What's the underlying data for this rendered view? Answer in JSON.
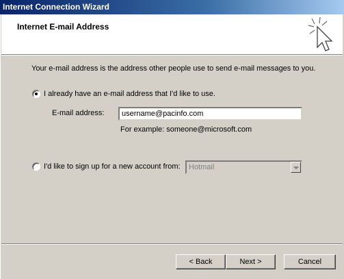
{
  "window": {
    "title": "Internet Connection Wizard"
  },
  "header": {
    "title": "Internet E-mail Address",
    "icon": "wizard-sparkle-cursor-icon"
  },
  "intro": "Your e-mail address is the address other people use to send e-mail messages to you.",
  "option_existing": {
    "label": "I already have an e-mail address that I'd like to use.",
    "selected": true,
    "email_label": "E-mail address:",
    "email_value": "username@pacinfo.com",
    "example": "For example: someone@microsoft.com"
  },
  "option_new": {
    "label": "I'd like to sign up for a new account from:",
    "selected": false,
    "provider": "Hotmail",
    "provider_enabled": false
  },
  "buttons": {
    "back": "< Back",
    "next": "Next >",
    "cancel": "Cancel"
  }
}
